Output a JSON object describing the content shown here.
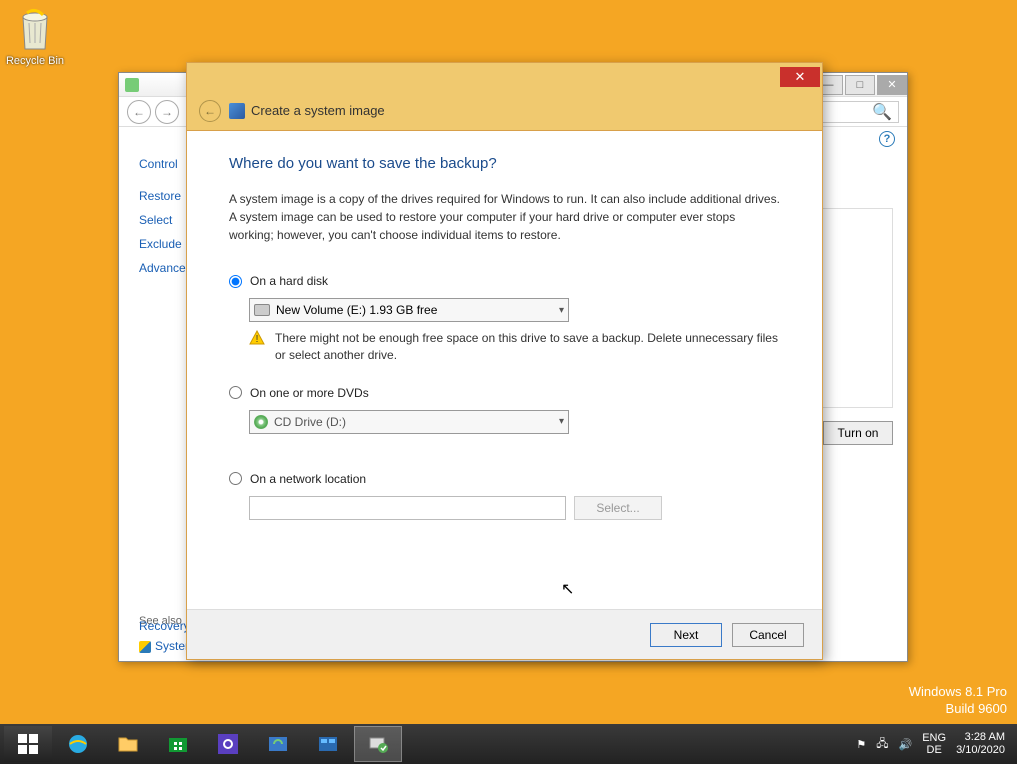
{
  "desktop": {
    "recycle_bin": "Recycle Bin"
  },
  "watermark": {
    "line1": "Windows 8.1 Pro",
    "line2": "Build 9600"
  },
  "control_panel": {
    "breadcrumb": "Control",
    "links": [
      "Restore",
      "Select",
      "Exclude",
      "Advanced"
    ],
    "turn_on": "Turn on",
    "see_also": "See also",
    "bottom_links": [
      "Recovery",
      "System"
    ]
  },
  "dialog": {
    "title": "Create a system image",
    "question": "Where do you want to save the backup?",
    "description": "A system image is a copy of the drives required for Windows to run. It can also include additional drives. A system image can be used to restore your computer if your hard drive or computer ever stops working; however, you can't choose individual items to restore.",
    "opt_hard_disk": "On a hard disk",
    "hd_value": "New Volume (E:)  1.93 GB free",
    "warning": "There might not be enough free space on this drive to save a backup. Delete unnecessary files or select another drive.",
    "opt_dvd": "On one or more DVDs",
    "dvd_value": "CD Drive (D:)",
    "opt_network": "On a network location",
    "select_btn": "Select...",
    "next": "Next",
    "cancel": "Cancel"
  },
  "systray": {
    "lang1": "ENG",
    "lang2": "DE",
    "time": "3:28 AM",
    "date": "3/10/2020"
  }
}
